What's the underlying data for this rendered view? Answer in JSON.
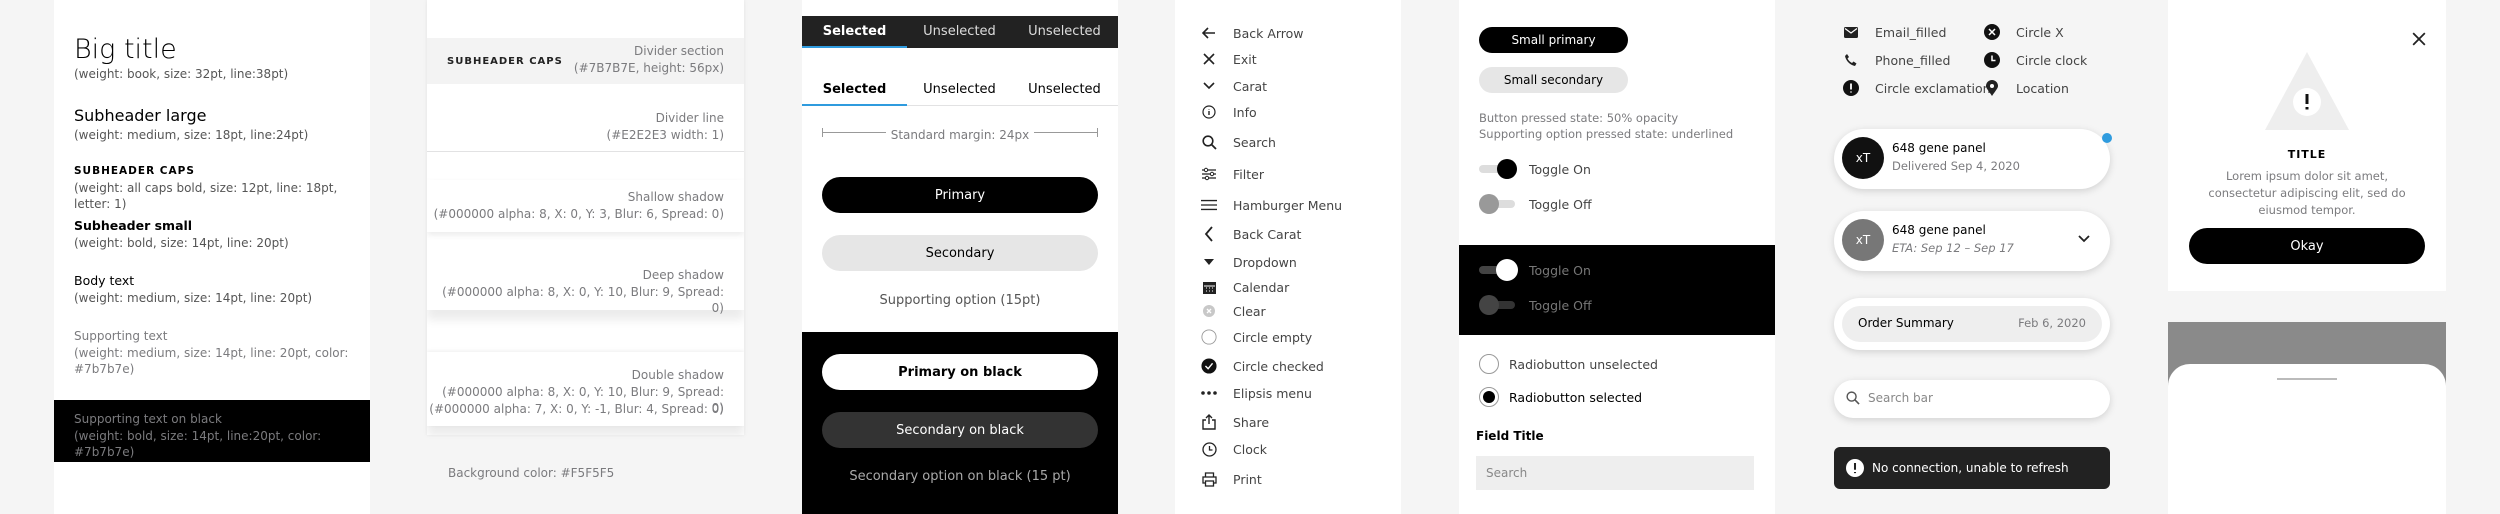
{
  "typography": {
    "big_title": "Big title",
    "big_title_desc": "(weight: book, size: 32pt, line:38pt)",
    "subheader_large": "Subheader large",
    "subheader_large_desc": "(weight: medium, size: 18pt, line:24pt)",
    "subheader_caps": "SUBHEADER CAPS",
    "subheader_caps_desc": "(weight: all caps bold, size: 12pt, line: 18pt, letter: 1)",
    "subheader_small": "Subheader small",
    "subheader_small_desc": "(weight: bold, size: 14pt, line: 20pt)",
    "body_text": "Body text",
    "body_text_desc": "(weight: medium, size: 14pt, line: 20pt)",
    "supporting_text": "Supporting text",
    "supporting_text_desc": "(weight: medium, size: 14pt, line: 20pt, color: #7b7b7e)",
    "supporting_black": "Supporting text on black",
    "supporting_black_desc": "(weight: bold, size: 14pt, line:20pt, color: #7b7b7e)"
  },
  "dividers": {
    "caps_label": "SUBHEADER CAPS",
    "divider_section": "Divider section",
    "divider_section_desc": "(#7B7B7E, height: 56px)",
    "divider_line": "Divider line",
    "divider_line_desc": "(#E2E2E3 width: 1)",
    "shallow_shadow": "Shallow shadow",
    "shallow_shadow_desc": "(#000000 alpha: 8, X: 0, Y: 3, Blur: 6, Spread: 0)",
    "deep_shadow": "Deep shadow",
    "deep_shadow_desc": "(#000000 alpha: 8, X: 0, Y: 10, Blur: 9, Spread: 0)",
    "double_shadow": "Double shadow",
    "double_shadow_desc1": "(#000000 alpha: 8, X: 0, Y: 10, Blur: 9, Spread: 0)",
    "double_shadow_desc2": "(#000000 alpha: 7, X: 0, Y: -1, Blur: 4, Spread: 0)",
    "background_color": "Background color: #F5F5F5"
  },
  "buttons": {
    "tabs_dark": [
      "Selected",
      "Unselected",
      "Unselected"
    ],
    "tabs_light": [
      "Selected",
      "Unselected",
      "Unselected"
    ],
    "margin_label": "Standard margin: 24px",
    "primary": "Primary",
    "secondary": "Secondary",
    "supporting_option": "Supporting option (15pt)",
    "primary_black": "Primary on black",
    "secondary_black": "Secondary on black",
    "secondary_option_black": "Secondary option on black (15 pt)"
  },
  "icons": [
    {
      "icon": "arrow-left-icon",
      "label": "Back Arrow"
    },
    {
      "icon": "close-icon",
      "label": "Exit"
    },
    {
      "icon": "chevron-down-icon",
      "label": "Carat"
    },
    {
      "icon": "info-icon",
      "label": "Info"
    },
    {
      "icon": "search-icon",
      "label": "Search"
    },
    {
      "icon": "filter-icon",
      "label": "Filter"
    },
    {
      "icon": "hamburger-icon",
      "label": "Hamburger Menu"
    },
    {
      "icon": "chevron-left-icon",
      "label": "Back Carat"
    },
    {
      "icon": "dropdown-icon",
      "label": "Dropdown"
    },
    {
      "icon": "calendar-icon",
      "label": "Calendar"
    },
    {
      "icon": "clear-icon",
      "label": "Clear"
    },
    {
      "icon": "circle-empty-icon",
      "label": "Circle empty"
    },
    {
      "icon": "circle-checked-icon",
      "label": "Circle checked"
    },
    {
      "icon": "ellipsis-icon",
      "label": "Elipsis menu"
    },
    {
      "icon": "share-icon",
      "label": "Share"
    },
    {
      "icon": "clock-icon",
      "label": "Clock"
    },
    {
      "icon": "print-icon",
      "label": "Print"
    }
  ],
  "controls": {
    "small_primary": "Small primary",
    "small_secondary": "Small secondary",
    "pressed_note1": "Button pressed state: 50% opacity",
    "pressed_note2": "Supporting option pressed state: underlined",
    "toggle_on": "Toggle On",
    "toggle_off": "Toggle Off",
    "toggle_on_dark": "Toggle On",
    "toggle_off_dark": "Toggle Off",
    "radio_unselected": "Radiobutton unselected",
    "radio_selected": "Radiobutton selected",
    "field_title": "Field Title",
    "field_placeholder": "Search"
  },
  "icons2": [
    {
      "icon": "email-icon",
      "label": "Email_filled"
    },
    {
      "icon": "phone-icon",
      "label": "Phone_filled"
    },
    {
      "icon": "circle-exclamation-icon",
      "label": "Circle exclamation"
    },
    {
      "icon": "circle-x-icon",
      "label": "Circle X"
    },
    {
      "icon": "circle-clock-icon",
      "label": "Circle clock"
    },
    {
      "icon": "location-icon",
      "label": "Location"
    }
  ],
  "cards": {
    "card1_avatar": "xT",
    "card1_title": "648 gene panel",
    "card1_sub": "Delivered Sep 4, 2020",
    "card2_avatar": "xT",
    "card2_title": "648 gene panel",
    "card2_sub": "ETA: Sep 12 – Sep 17",
    "order_label": "Order Summary",
    "order_date": "Feb 6, 2020",
    "search_placeholder": "Search bar",
    "error_text": "No connection, unable to refresh",
    "accent": "#2f9bde"
  },
  "dialog": {
    "title": "TITLE",
    "body": "Lorem ipsum dolor sit amet, consectetur adipiscing elit, sed do eiusmod tempor.",
    "okay": "Okay"
  }
}
